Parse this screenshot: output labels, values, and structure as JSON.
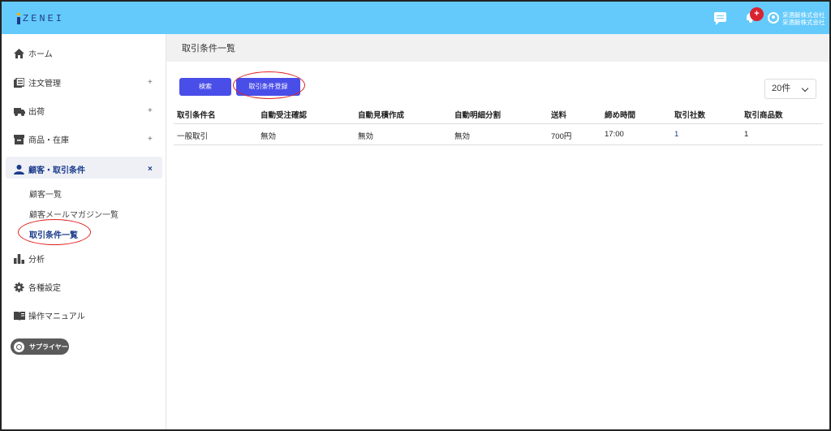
{
  "header": {
    "logo_text": "ZENEI",
    "notification_count": "+",
    "account_line1": "采酒飯株式会社",
    "account_line2": "采酒飯株式会社",
    "bg_color": "#64cafc",
    "icons": [
      "chat-icon",
      "bell-icon",
      "account-icon"
    ]
  },
  "sidebar": {
    "items": [
      {
        "label": "ホーム",
        "icon": "home-icon"
      },
      {
        "label": "注文管理",
        "icon": "order-icon",
        "expand": "+"
      },
      {
        "label": "出荷",
        "icon": "truck-icon",
        "expand": "+"
      },
      {
        "label": "商品・在庫",
        "icon": "inventory-icon",
        "expand": "+"
      },
      {
        "label": "顧客・取引条件",
        "icon": "person-icon",
        "expand": "×"
      },
      {
        "label": "分析",
        "icon": "chart-icon"
      },
      {
        "label": "各種設定",
        "icon": "gear-icon"
      },
      {
        "label": "操作マニュアル",
        "icon": "book-icon"
      }
    ],
    "subitems": [
      {
        "label": "顧客一覧"
      },
      {
        "label": "顧客メールマガジン一覧"
      },
      {
        "label": "取引条件一覧"
      }
    ],
    "supplier_label": "サプライヤー"
  },
  "main": {
    "title": "取引条件一覧",
    "search_button": "検索",
    "register_button": "取引条件登録",
    "per_page": "20件",
    "table": {
      "headers": [
        "取引条件名",
        "自動受注確認",
        "自動見積作成",
        "自動明細分割",
        "送料",
        "締め時間",
        "取引社数",
        "取引商品数"
      ],
      "rows": [
        [
          "一般取引",
          "無効",
          "無効",
          "無効",
          "700円",
          "17:00",
          "1",
          "1"
        ]
      ]
    },
    "accent_color": "#4a4ee8",
    "highlight_color": "#e02020"
  }
}
